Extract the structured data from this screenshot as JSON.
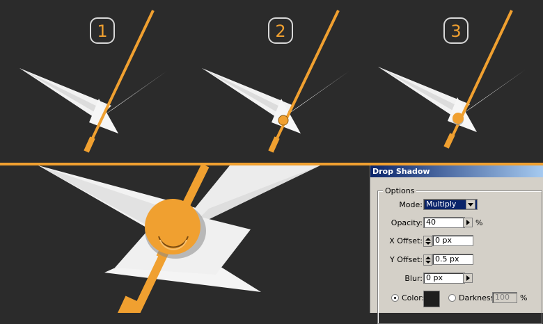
{
  "steps": [
    "1",
    "2",
    "3"
  ],
  "colors": {
    "background": "#2b2b2b",
    "accent": "#f0a030",
    "hand": "#f2f2f2",
    "swatch": "#1e1e1e"
  },
  "dialog": {
    "title": "Drop Shadow",
    "group_label": "Options",
    "mode": {
      "label": "Mode:",
      "value": "Multiply"
    },
    "opacity": {
      "label": "Opacity:",
      "value": "40",
      "unit": "%"
    },
    "x_offset": {
      "label": "X Offset:",
      "value": "0 px"
    },
    "y_offset": {
      "label": "Y Offset:",
      "value": "0.5 px"
    },
    "blur": {
      "label": "Blur:",
      "value": "0 px"
    },
    "color": {
      "label": "Color:",
      "selected": true
    },
    "darkness": {
      "label": "Darkness:",
      "value": "100",
      "unit": "%",
      "selected": false
    }
  }
}
